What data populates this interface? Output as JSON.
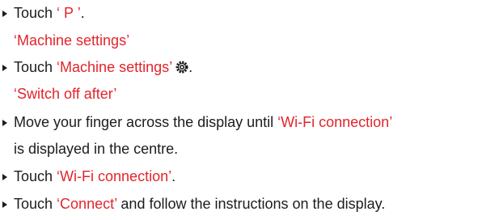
{
  "colors": {
    "text": "#1c1c1c",
    "highlight": "#e3242b"
  },
  "steps": [
    {
      "prefix": "Touch ",
      "highlight": "‘ P ’",
      "suffix": ".",
      "result": "‘Machine settings’"
    },
    {
      "prefix": "Touch ",
      "highlight": "‘Machine settings’",
      "icon": "gear-icon",
      "suffix": ".",
      "result": "‘Switch off after’"
    },
    {
      "prefix": "Move your finger across the display until ",
      "highlight": "‘Wi-Fi connection’",
      "suffix": "",
      "continuation": "is displayed in the centre."
    },
    {
      "prefix": "Touch ",
      "highlight": "‘Wi-Fi connection’",
      "suffix": "."
    },
    {
      "prefix": "Touch ",
      "highlight": "‘Connect’",
      "suffix": " and follow the instructions on the display."
    }
  ]
}
